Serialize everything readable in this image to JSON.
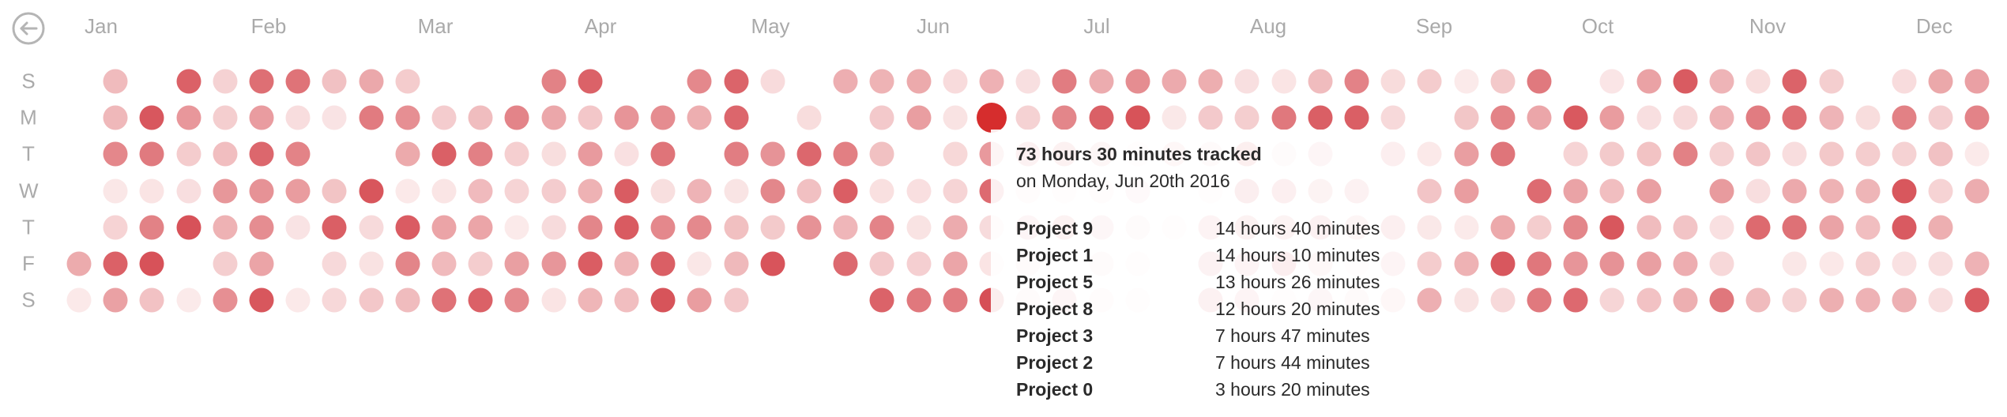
{
  "calendar": {
    "year": "2016",
    "months": [
      "Jan",
      "Feb",
      "Mar",
      "Apr",
      "May",
      "Jun",
      "Jul",
      "Aug",
      "Sep",
      "Oct",
      "Nov",
      "Dec"
    ],
    "weekdays": [
      "S",
      "M",
      "T",
      "W",
      "T",
      "F",
      "S"
    ],
    "selected_day": "Monday, Jun 20th 2016"
  },
  "colors": {
    "dot_light": "#fbeaea",
    "dot_dark": "#d0343c",
    "selected": "#d62d2d",
    "label": "#aaaaaa"
  },
  "tooltip": {
    "title": "73 hours 30 minutes tracked",
    "subtitle": "on Monday, Jun 20th 2016",
    "rows": [
      {
        "project": "Project 9",
        "time": "14 hours 40 minutes"
      },
      {
        "project": "Project 1",
        "time": "14 hours 10 minutes"
      },
      {
        "project": "Project 5",
        "time": "13 hours 26 minutes"
      },
      {
        "project": "Project 8",
        "time": "12 hours 20 minutes"
      },
      {
        "project": "Project 3",
        "time": "7 hours 47 minutes"
      },
      {
        "project": "Project 2",
        "time": "7 hours 44 minutes"
      },
      {
        "project": "Project 0",
        "time": "3 hours 20 minutes"
      }
    ]
  },
  "icons": {
    "back": "back-arrow-icon"
  }
}
